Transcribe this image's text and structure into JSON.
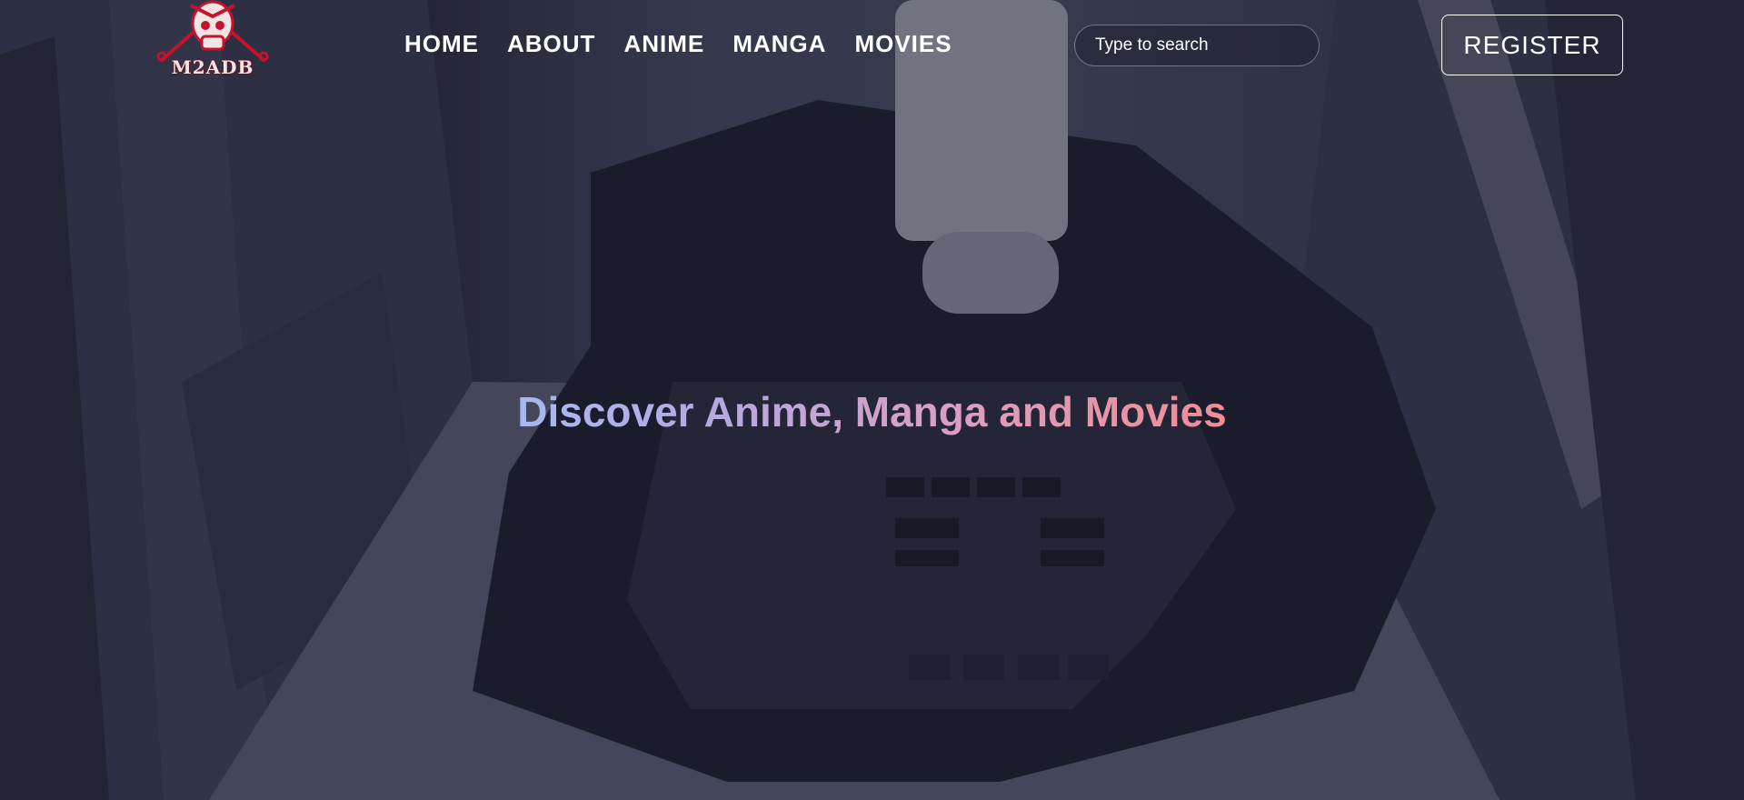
{
  "brand": {
    "logo_text": "M2ADB",
    "logo_icon": "skull-crossed-swords-icon",
    "accent_color": "#c4132c"
  },
  "nav": {
    "items": [
      {
        "label": "HOME"
      },
      {
        "label": "ABOUT"
      },
      {
        "label": "ANIME"
      },
      {
        "label": "MANGA"
      },
      {
        "label": "MOVIES"
      }
    ]
  },
  "search": {
    "placeholder": "Type to search",
    "value": ""
  },
  "register": {
    "label": "REGISTER"
  },
  "hero": {
    "title": "Discover Anime, Manga and Movies",
    "gradient_colors": [
      "#a7b7f2",
      "#d9a0c3",
      "#f08d93"
    ]
  }
}
